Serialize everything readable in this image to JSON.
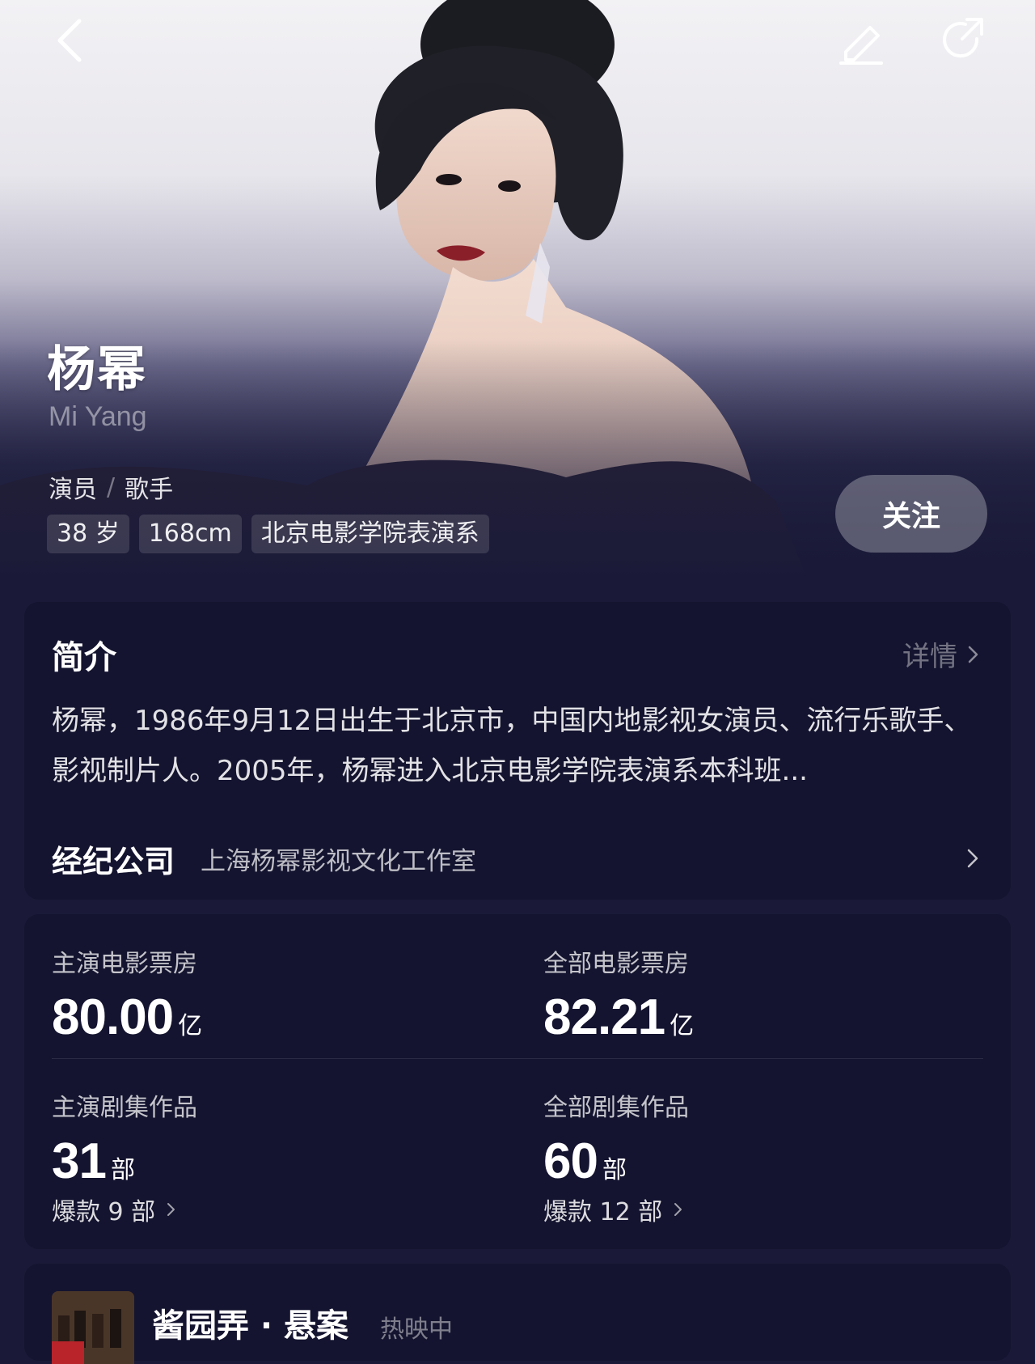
{
  "header": {
    "back_icon": "chevron-left-icon",
    "edit_icon": "pencil-icon",
    "share_icon": "share-icon"
  },
  "profile": {
    "name_cn": "杨幂",
    "name_en": "Mi Yang",
    "roles": [
      "演员",
      "歌手"
    ],
    "role_separator": "/",
    "tags": [
      "38 岁",
      "168cm",
      "北京电影学院表演系"
    ],
    "follow_label": "关注"
  },
  "intro": {
    "title": "简介",
    "detail_label": "详情",
    "text": "杨幂，1986年9月12日出生于北京市，中国内地影视女演员、流行乐歌手、影视制片人。2005年，杨幂进入北京电影学院表演系本科班...",
    "agency_label": "经纪公司",
    "agency_value": "上海杨幂影视文化工作室"
  },
  "stats": {
    "lead_box_office": {
      "label": "主演电影票房",
      "value": "80.00",
      "unit": "亿"
    },
    "all_box_office": {
      "label": "全部电影票房",
      "value": "82.21",
      "unit": "亿"
    },
    "lead_series": {
      "label": "主演剧集作品",
      "value": "31",
      "unit": "部",
      "sub": "爆款 9 部"
    },
    "all_series": {
      "label": "全部剧集作品",
      "value": "60",
      "unit": "部",
      "sub": "爆款 12 部"
    }
  },
  "film": {
    "title": "酱园弄 · 悬案",
    "status": "热映中"
  },
  "colors": {
    "background": "#1a1a38",
    "card": "#141430",
    "text_primary": "#ffffff"
  }
}
